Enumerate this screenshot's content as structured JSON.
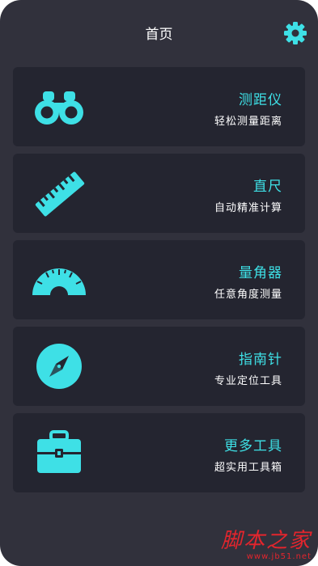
{
  "header": {
    "title": "首页",
    "settings_icon": "gear-icon"
  },
  "accent_color": "#3ee0e6",
  "cards": [
    {
      "title": "测距仪",
      "subtitle": "轻松测量距离",
      "icon": "binoculars-icon"
    },
    {
      "title": "直尺",
      "subtitle": "自动精准计算",
      "icon": "ruler-icon"
    },
    {
      "title": "量角器",
      "subtitle": "任意角度测量",
      "icon": "protractor-icon"
    },
    {
      "title": "指南针",
      "subtitle": "专业定位工具",
      "icon": "compass-icon"
    },
    {
      "title": "更多工具",
      "subtitle": "超实用工具箱",
      "icon": "toolbox-icon"
    }
  ],
  "watermark": {
    "text": "脚本之家",
    "url": "www.jb51.net"
  }
}
